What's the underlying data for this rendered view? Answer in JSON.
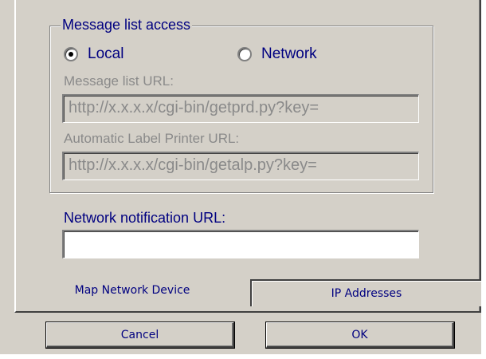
{
  "group": {
    "title": "Message list access"
  },
  "access": {
    "local_label": "Local",
    "network_label": "Network",
    "selected": "Local"
  },
  "message_list_url": {
    "label": "Message list URL:",
    "value": "http://x.x.x.x/cgi-bin/getprd.py?key="
  },
  "label_printer_url": {
    "label": "Automatic Label Printer URL:",
    "value": "http://x.x.x.x/cgi-bin/getalp.py?key="
  },
  "network_notification_url": {
    "label": "Network notification URL:",
    "value": ""
  },
  "tabs": [
    {
      "label": "Map Network Device",
      "active": true
    },
    {
      "label": "IP Addresses",
      "active": false
    }
  ],
  "buttons": {
    "cancel": "Cancel",
    "ok": "OK"
  },
  "colors": {
    "face": "#d4d0c8",
    "label_blue": "#000080",
    "disabled_text": "#8a8a8a"
  }
}
